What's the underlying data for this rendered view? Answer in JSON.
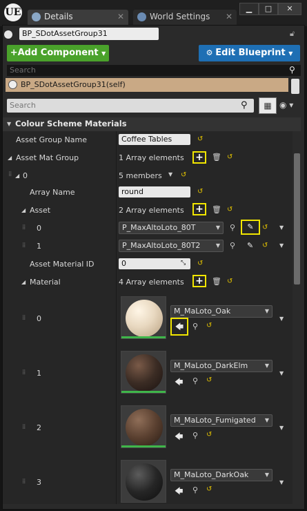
{
  "window": {
    "logo": "UE",
    "tabs": [
      {
        "label": "Details",
        "icon": "info-icon",
        "active": true
      },
      {
        "label": "World Settings",
        "icon": "globe-icon",
        "active": false
      }
    ],
    "controls": {
      "minimize": "▁",
      "maximize": "□",
      "close": "✕"
    }
  },
  "actor": {
    "name": "BP_SDotAssetGroup31"
  },
  "toolbar": {
    "add_component": "+Add Component",
    "edit_blueprint": "Edit Blueprint"
  },
  "component_search": {
    "placeholder": "Search"
  },
  "component_tree": {
    "item": "BP_SDotAssetGroup31(self)"
  },
  "details_search": {
    "placeholder": "Search"
  },
  "section": {
    "title": "Colour Scheme Materials"
  },
  "properties": {
    "asset_group_name": {
      "label": "Asset Group Name",
      "value": "Coffee Tables"
    },
    "asset_mat_group": {
      "label": "Asset Mat Group",
      "value": "1 Array elements"
    },
    "group_index": {
      "label": "0",
      "value": "5 members"
    },
    "array_name": {
      "label": "Array Name",
      "value": "round"
    },
    "asset": {
      "label": "Asset",
      "value": "2 Array elements",
      "items": [
        {
          "index": "0",
          "value": "P_MaxAltoLoto_80T"
        },
        {
          "index": "1",
          "value": "P_MaxAltoLoto_80T2"
        }
      ]
    },
    "asset_material_id": {
      "label": "Asset Material ID",
      "value": "0"
    },
    "material": {
      "label": "Material",
      "value": "4 Array elements",
      "items": [
        {
          "index": "0",
          "value": "M_MaLoto_Oak",
          "color": "#e8d8c0"
        },
        {
          "index": "1",
          "value": "M_MaLoto_DarkElm",
          "color": "#3b2c24"
        },
        {
          "index": "2",
          "value": "M_MaLoto_Fumigated",
          "color": "#5a4030"
        },
        {
          "index": "3",
          "value": "M_MaLoto_DarkOak",
          "color": "#262626"
        }
      ]
    }
  },
  "colors": {
    "add_green": "#4aa22b",
    "edit_blue": "#1e6fb4",
    "highlight": "#f2e600",
    "selected_row": "#c9a985"
  }
}
